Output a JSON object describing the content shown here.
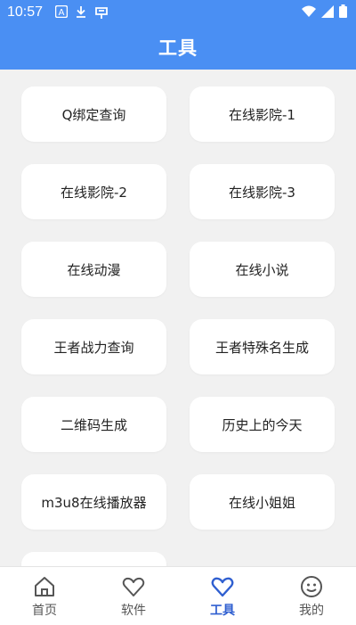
{
  "status": {
    "time": "10:57",
    "icons": [
      "a-icon",
      "download-icon",
      "app-icon",
      "wifi-icon",
      "signal-icon",
      "battery-icon"
    ]
  },
  "header": {
    "title": "工具"
  },
  "tools": [
    "Q绑定查询",
    "在线影院-1",
    "在线影院-2",
    "在线影院-3",
    "在线动漫",
    "在线小说",
    "王者战力查询",
    "王者特殊名生成",
    "二维码生成",
    "历史上的今天",
    "m3u8在线播放器",
    "在线小姐姐"
  ],
  "tabs": [
    {
      "label": "首页",
      "icon": "home-icon",
      "active": false
    },
    {
      "label": "软件",
      "icon": "heart-icon",
      "active": false
    },
    {
      "label": "工具",
      "icon": "heart-icon",
      "active": true
    },
    {
      "label": "我的",
      "icon": "smiley-icon",
      "active": false
    }
  ],
  "colors": {
    "header": "#4a8ff3",
    "background": "#f1f1f1",
    "active_tab": "#2f5fd0"
  }
}
